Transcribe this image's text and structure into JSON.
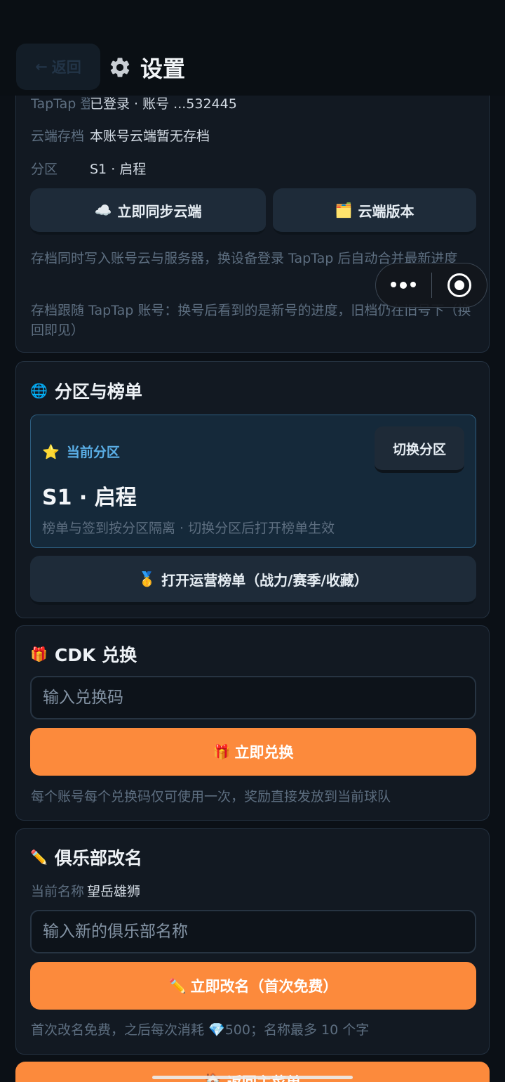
{
  "header": {
    "back_label": "返回",
    "title": "设置"
  },
  "account": {
    "rows": [
      {
        "label": "TapTap 登",
        "value": "已登录 · 账号 ...532445"
      },
      {
        "label": "云端存档",
        "value": "本账号云端暂无存档"
      },
      {
        "label": "分区",
        "value": "S1 · 启程"
      }
    ],
    "sync_button": "立即同步云端",
    "versions_button": "云端版本",
    "note1": "存档同时写入账号云与服务器，换设备登录 TapTap 后自动合并最新进度",
    "note2": "存档跟随 TapTap 账号：换号后看到的是新号的进度，旧档仍在旧号下（换回即见）"
  },
  "zone": {
    "title": "分区与榜单",
    "current_label": "当前分区",
    "switch_button": "切换分区",
    "current_name": "S1 · 启程",
    "hint": "榜单与签到按分区隔离 · 切换分区后打开榜单生效",
    "leaderboard_button": "打开运营榜单（战力/赛季/收藏）"
  },
  "cdk": {
    "title": "CDK 兑换",
    "placeholder": "输入兑换码",
    "redeem_button": "立即兑换",
    "note": "每个账号每个兑换码仅可使用一次，奖励直接发放到当前球队"
  },
  "rename": {
    "title": "俱乐部改名",
    "current_label": "当前名称",
    "current_value": "望岳雄狮",
    "placeholder": "输入新的俱乐部名称",
    "rename_button": "立即改名（首次免费）",
    "note": "首次改名免费，之后每次消耗 💎500；名称最多 10 个字"
  },
  "footer": {
    "home_button": "返回主菜单"
  },
  "colors": {
    "accent": "#fc8a3c",
    "card_bg": "#121922",
    "highlight_blue": "#5aaee6"
  }
}
